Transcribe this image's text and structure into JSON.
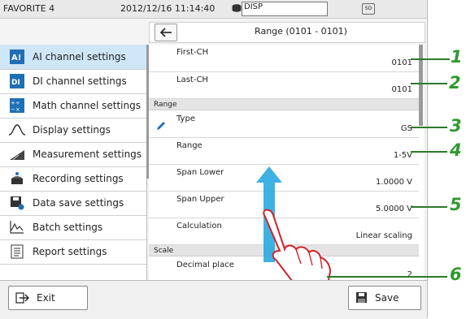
{
  "status": {
    "name": "FAVORITE 4",
    "datetime": "2012/12/16 11:14:40",
    "disp": "DISP",
    "sd": "SD"
  },
  "header": {
    "back_label": "←",
    "title": "Range (0101 - 0101)"
  },
  "sidebar": {
    "items": [
      {
        "label": "AI channel settings",
        "icon": "ai-channel-icon",
        "selected": true
      },
      {
        "label": "DI channel settings",
        "icon": "di-channel-icon"
      },
      {
        "label": "Math channel settings",
        "icon": "math-channel-icon"
      },
      {
        "label": "Display settings",
        "icon": "display-wave-icon"
      },
      {
        "label": "Measurement settings",
        "icon": "measurement-icon"
      },
      {
        "label": "Recording settings",
        "icon": "recording-icon"
      },
      {
        "label": "Data save settings",
        "icon": "data-save-icon"
      },
      {
        "label": "Batch settings",
        "icon": "batch-icon"
      },
      {
        "label": "Report settings",
        "icon": "report-icon"
      }
    ]
  },
  "content": {
    "first_ch": {
      "label": "First-CH",
      "value": "0101"
    },
    "last_ch": {
      "label": "Last-CH",
      "value": "0101"
    },
    "range_header": "Range",
    "type": {
      "label": "Type",
      "value": "GS"
    },
    "range": {
      "label": "Range",
      "value": "1-5V"
    },
    "span_lower": {
      "label": "Span Lower",
      "value": "1.0000 V"
    },
    "span_upper": {
      "label": "Span Upper",
      "value": "5.0000 V"
    },
    "calculation": {
      "label": "Calculation",
      "value": "Linear scaling"
    },
    "scale_header": "Scale",
    "decimal_place": {
      "label": "Decimal place",
      "value": "2"
    }
  },
  "footer": {
    "exit_label": "Exit",
    "save_label": "Save"
  },
  "callouts": [
    "1",
    "2",
    "3",
    "4",
    "5",
    "6"
  ],
  "colors": {
    "selected_bg": "#cfe6f7",
    "callout_green": "#2f9a2f",
    "arrow_blue": "#2aa8e0"
  }
}
